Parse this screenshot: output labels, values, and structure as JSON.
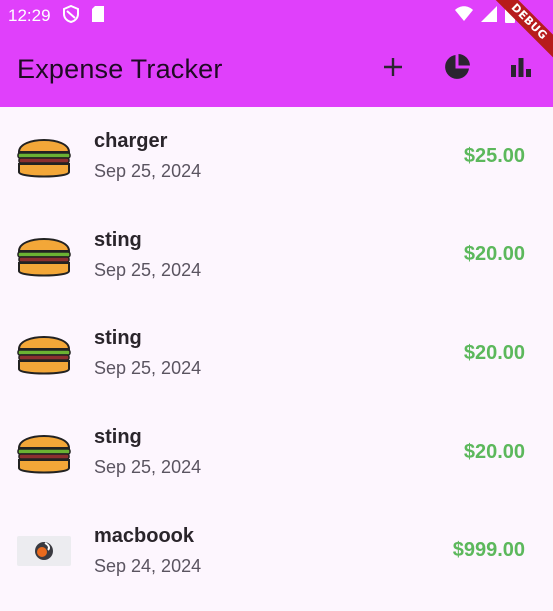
{
  "status": {
    "time": "12:29"
  },
  "app_bar": {
    "title": "Expense Tracker",
    "actions": [
      {
        "icon": "add-icon"
      },
      {
        "icon": "pie-chart-icon"
      },
      {
        "icon": "bar-chart-icon"
      }
    ]
  },
  "debug_banner": "DEBUG",
  "expenses": [
    {
      "title": "charger",
      "date": "Sep 25, 2024",
      "amount": "$25.00",
      "icon": "burger-icon"
    },
    {
      "title": "sting",
      "date": "Sep 25, 2024",
      "amount": "$20.00",
      "icon": "burger-icon"
    },
    {
      "title": "sting",
      "date": "Sep 25, 2024",
      "amount": "$20.00",
      "icon": "burger-icon"
    },
    {
      "title": "sting",
      "date": "Sep 25, 2024",
      "amount": "$20.00",
      "icon": "burger-icon"
    },
    {
      "title": "macboook",
      "date": "Sep 24, 2024",
      "amount": "$999.00",
      "icon": "laptop-icon"
    }
  ],
  "colors": {
    "app_bar": "#e040fb",
    "amount": "#5cb85c",
    "background": "#fdf6fe"
  }
}
